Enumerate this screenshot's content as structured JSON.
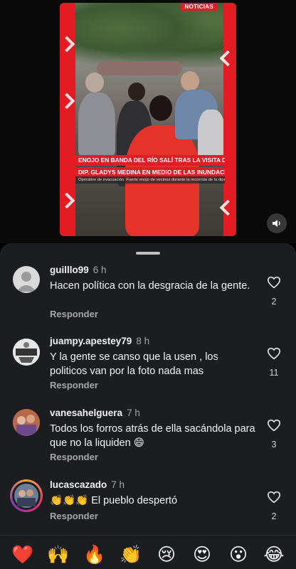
{
  "video": {
    "news_tag": "NOTICIAS",
    "caption_line_1": "ENOJO EN BANDA DEL RÍO SALÍ TRAS LA VISITA DE LA",
    "caption_line_2": "DIP. GLADYS MEDINA EN MEDIO DE LAS INUNDACIONES",
    "subcaption": "Operativo de evacuación: Fuerte enojo de vecinos durante la recorrida de la diputada",
    "sound_icon": "speaker-icon"
  },
  "comments": [
    {
      "username": "guilllo99",
      "time": "6 h",
      "text": "Hacen política con la desgracia de la gente.",
      "reply_label": "Responder",
      "likes": "2"
    },
    {
      "username": "juampy.apestey79",
      "time": "8 h",
      "text": "Y la gente se canso que la usen , los politicos van por la foto nada mas",
      "reply_label": "Responder",
      "likes": "11"
    },
    {
      "username": "vanesahelguera",
      "time": "7 h",
      "text": "Todos los forros atrás de ella sacándola para que no la liquiden 😄",
      "reply_label": "Responder",
      "likes": "3"
    },
    {
      "username": "lucascazado",
      "time": "7 h",
      "text": "👏👏👏 El pueblo despertó",
      "reply_label": "Responder",
      "likes": "2"
    }
  ],
  "emoji_bar": [
    "❤️",
    "🙌",
    "🔥",
    "👏",
    "😢",
    "😍",
    "😮",
    "😂"
  ],
  "colors": {
    "sheet_bg": "#1c1d21",
    "accent_red": "#e31b23",
    "muted_text": "#a7a7a7"
  }
}
